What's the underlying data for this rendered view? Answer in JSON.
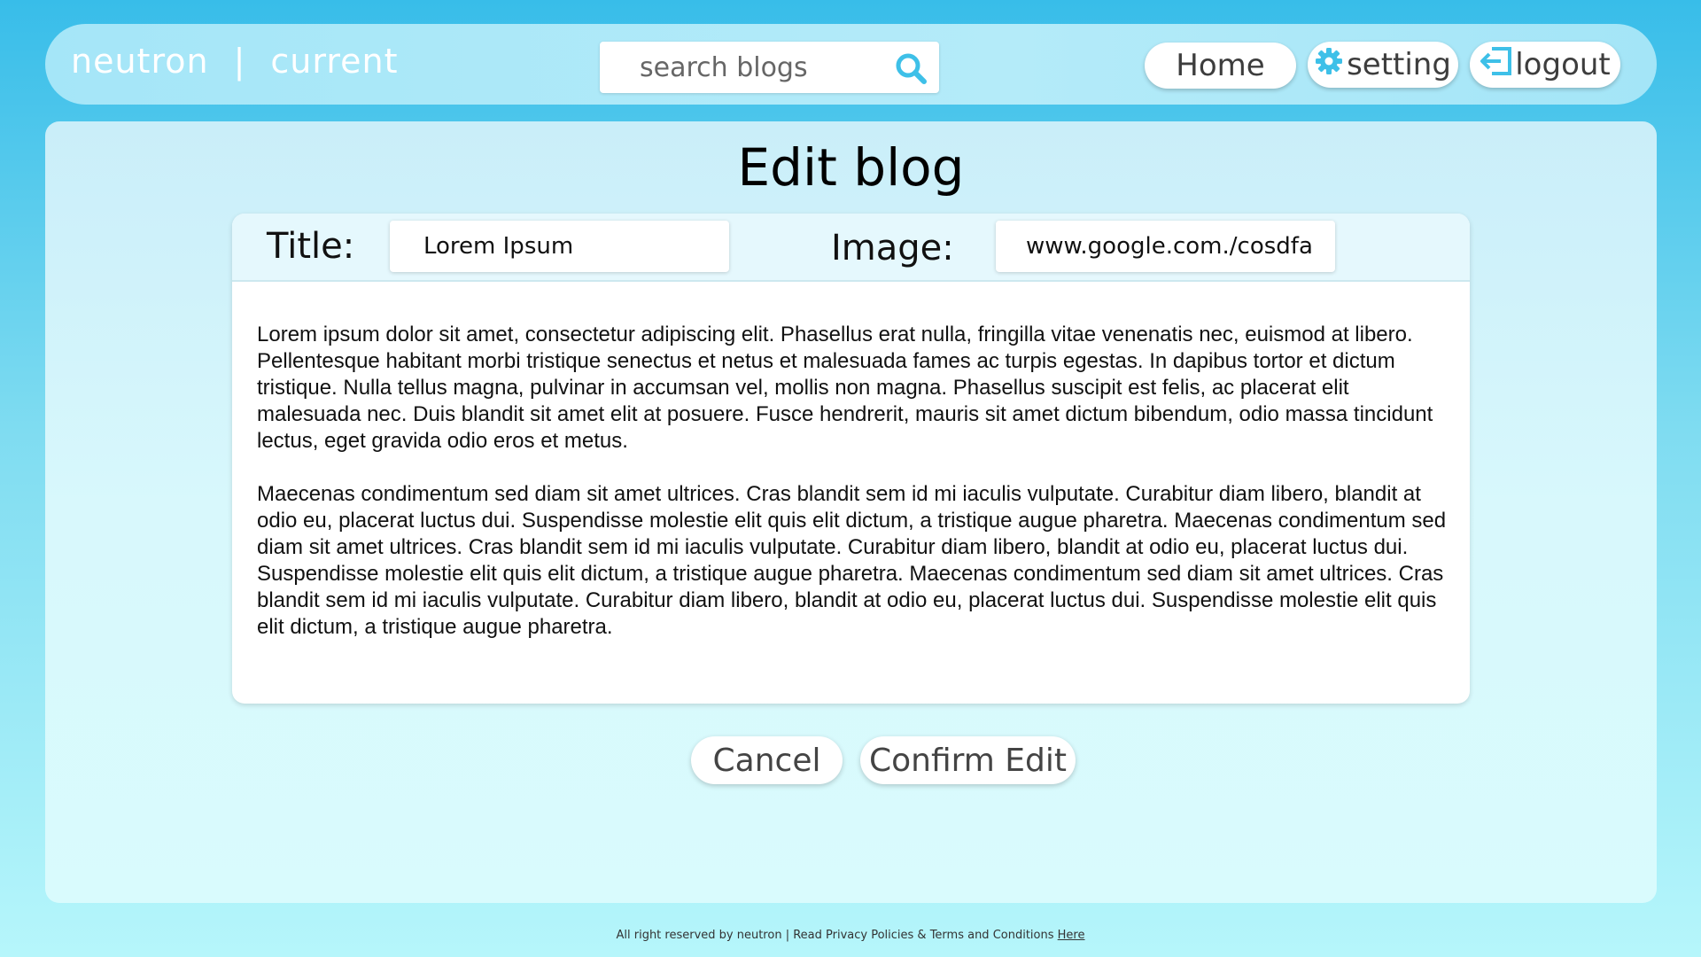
{
  "brand": {
    "name": "neutron",
    "separator": "|",
    "section": "current"
  },
  "search": {
    "placeholder": "search blogs",
    "icon": "search-icon"
  },
  "nav": {
    "home_label": "Home",
    "setting_label": "setting",
    "setting_icon": "gear-icon",
    "logout_label": "logout",
    "logout_icon": "logout-icon"
  },
  "page": {
    "title": "Edit blog"
  },
  "form": {
    "title_label": "Title:",
    "title_value": "Lorem Ipsum",
    "image_label": "Image:",
    "image_value": "www.google.com./cosdfa",
    "body_paragraphs": [
      "Lorem ipsum dolor sit amet, consectetur adipiscing elit. Phasellus erat nulla, fringilla vitae venenatis nec, euismod at libero. Pellentesque habitant morbi tristique senectus et netus et malesuada fames ac turpis egestas. In dapibus tortor et dictum tristique. Nulla tellus magna, pulvinar in accumsan vel, mollis non magna. Phasellus suscipit est felis, ac placerat elit malesuada nec. Duis blandit sit amet elit at posuere. Fusce hendrerit, mauris sit amet dictum bibendum, odio massa tincidunt lectus, eget gravida odio eros et metus.",
      "Maecenas condimentum sed diam sit amet ultrices. Cras blandit sem id mi iaculis vulputate. Curabitur diam libero, blandit at odio eu, placerat luctus dui. Suspendisse molestie elit quis elit dictum, a tristique augue pharetra. Maecenas condimentum sed diam sit amet ultrices. Cras blandit sem id mi iaculis vulputate. Curabitur diam libero, blandit at odio eu, placerat luctus dui. Suspendisse molestie elit quis elit dictum, a tristique augue pharetra. Maecenas condimentum sed diam sit amet ultrices. Cras blandit sem id mi iaculis vulputate. Curabitur diam libero, blandit at odio eu, placerat luctus dui. Suspendisse molestie elit quis elit dictum, a tristique augue pharetra."
    ]
  },
  "actions": {
    "cancel_label": "Cancel",
    "confirm_label": "Confirm Edit"
  },
  "footer": {
    "text": "All right reserved by neutron | Read Privacy Policies & Terms and Conditions",
    "link_label": "Here"
  },
  "colors": {
    "accent": "#3ec0e8",
    "navbar_bg": "#a8e7f8",
    "card_bg": "#d2f4fb",
    "header_strip": "#e5f8fd"
  }
}
